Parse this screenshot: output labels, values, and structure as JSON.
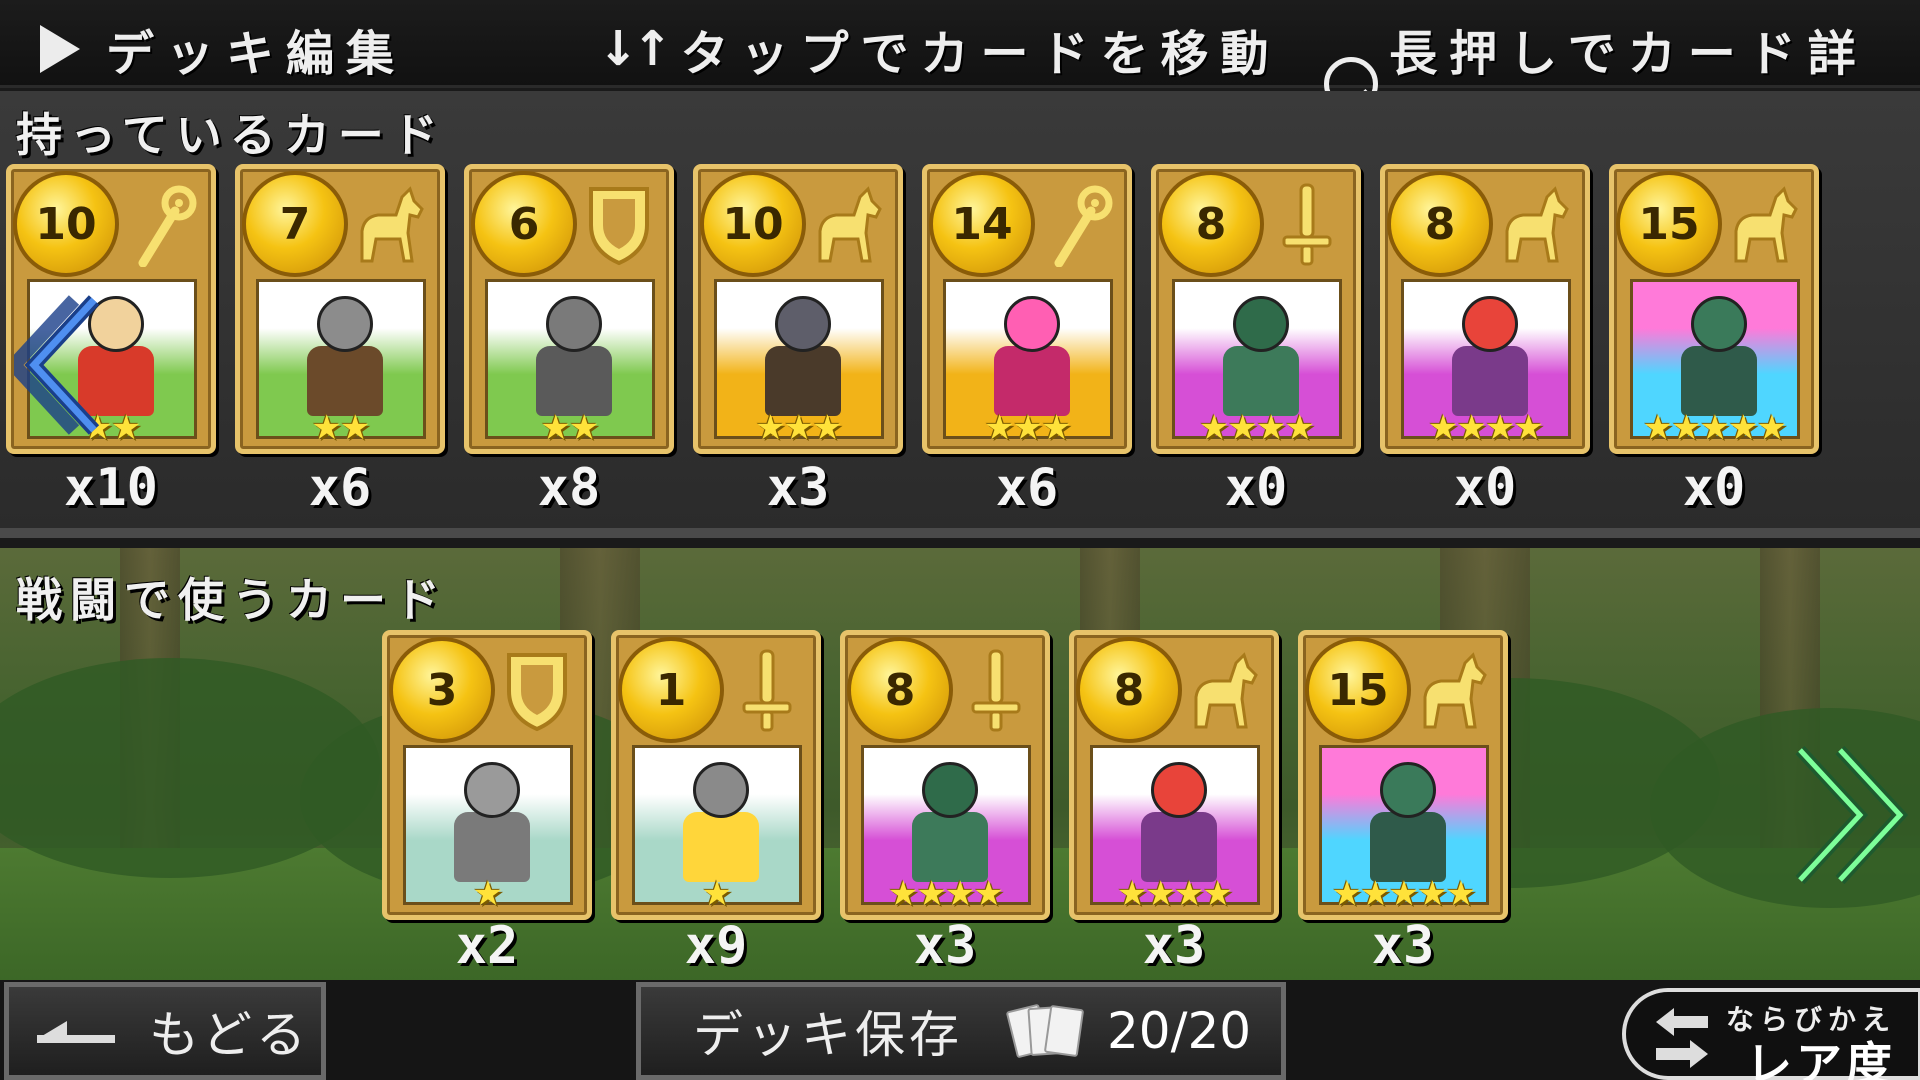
{
  "header": {
    "title": "デッキ編集",
    "move_hint": "タップでカードを移動",
    "detail_hint": "長押しでカード詳細"
  },
  "owned": {
    "title": "持っているカード",
    "cards": [
      {
        "cost": "10",
        "type": "staff-icon",
        "stars": "★★",
        "count": "x10",
        "art": "hooded-girl",
        "bg": [
          "#ffffff",
          "#7fc94f"
        ]
      },
      {
        "cost": "7",
        "type": "horse-icon",
        "stars": "★★",
        "count": "x6",
        "art": "knight-rider",
        "bg": [
          "#ffffff",
          "#7fc94f"
        ]
      },
      {
        "cost": "6",
        "type": "shield-icon",
        "stars": "★★",
        "count": "x8",
        "art": "shield-knight",
        "bg": [
          "#ffffff",
          "#7fc94f"
        ]
      },
      {
        "cost": "10",
        "type": "horse-icon",
        "stars": "★★★",
        "count": "x3",
        "art": "dark-rider",
        "bg": [
          "#ffffff",
          "#f2b318"
        ]
      },
      {
        "cost": "14",
        "type": "staff-icon",
        "stars": "★★★",
        "count": "x6",
        "art": "pink-mage",
        "bg": [
          "#ffffff",
          "#f2b318"
        ]
      },
      {
        "cost": "8",
        "type": "sword-icon",
        "stars": "★★★★",
        "count": "x0",
        "art": "horned-warrior",
        "bg": [
          "#ffffff",
          "#d64fd6"
        ]
      },
      {
        "cost": "8",
        "type": "horse-icon",
        "stars": "★★★★",
        "count": "x0",
        "art": "red-hair-rider",
        "bg": [
          "#ffffff",
          "#d64fd6"
        ]
      },
      {
        "cost": "15",
        "type": "horse-icon",
        "stars": "★★★★★",
        "count": "x0",
        "art": "green-knight-rider",
        "bg": [
          "#ff7ad9",
          "#4fd6ff"
        ]
      }
    ]
  },
  "battle": {
    "title": "戦闘で使うカード",
    "cards": [
      {
        "cost": "3",
        "type": "shield-icon",
        "stars": "★",
        "count": "x2",
        "art": "small-knight",
        "bg": [
          "#ffffff",
          "#a9d8c8"
        ]
      },
      {
        "cost": "1",
        "type": "sword-icon",
        "stars": "★",
        "count": "x9",
        "art": "chick",
        "bg": [
          "#ffffff",
          "#a9d8c8"
        ]
      },
      {
        "cost": "8",
        "type": "sword-icon",
        "stars": "★★★★",
        "count": "x3",
        "art": "horned-warrior",
        "bg": [
          "#ffffff",
          "#d64fd6"
        ]
      },
      {
        "cost": "8",
        "type": "horse-icon",
        "stars": "★★★★",
        "count": "x3",
        "art": "red-hair-rider",
        "bg": [
          "#ffffff",
          "#d64fd6"
        ]
      },
      {
        "cost": "15",
        "type": "horse-icon",
        "stars": "★★★★★",
        "count": "x3",
        "art": "green-knight-rider",
        "bg": [
          "#ff7ad9",
          "#4fd6ff"
        ]
      }
    ]
  },
  "footer": {
    "back_label": "もどる",
    "save_label": "デッキ保存",
    "deck_count": "20/20",
    "sort_small": "ならびかえ",
    "sort_big": "レア度"
  },
  "colors": {
    "card_gold": "#c99a3e",
    "coin": "#f5c313",
    "star": "#ffe23a",
    "arrow_green": "#7dff9a"
  }
}
